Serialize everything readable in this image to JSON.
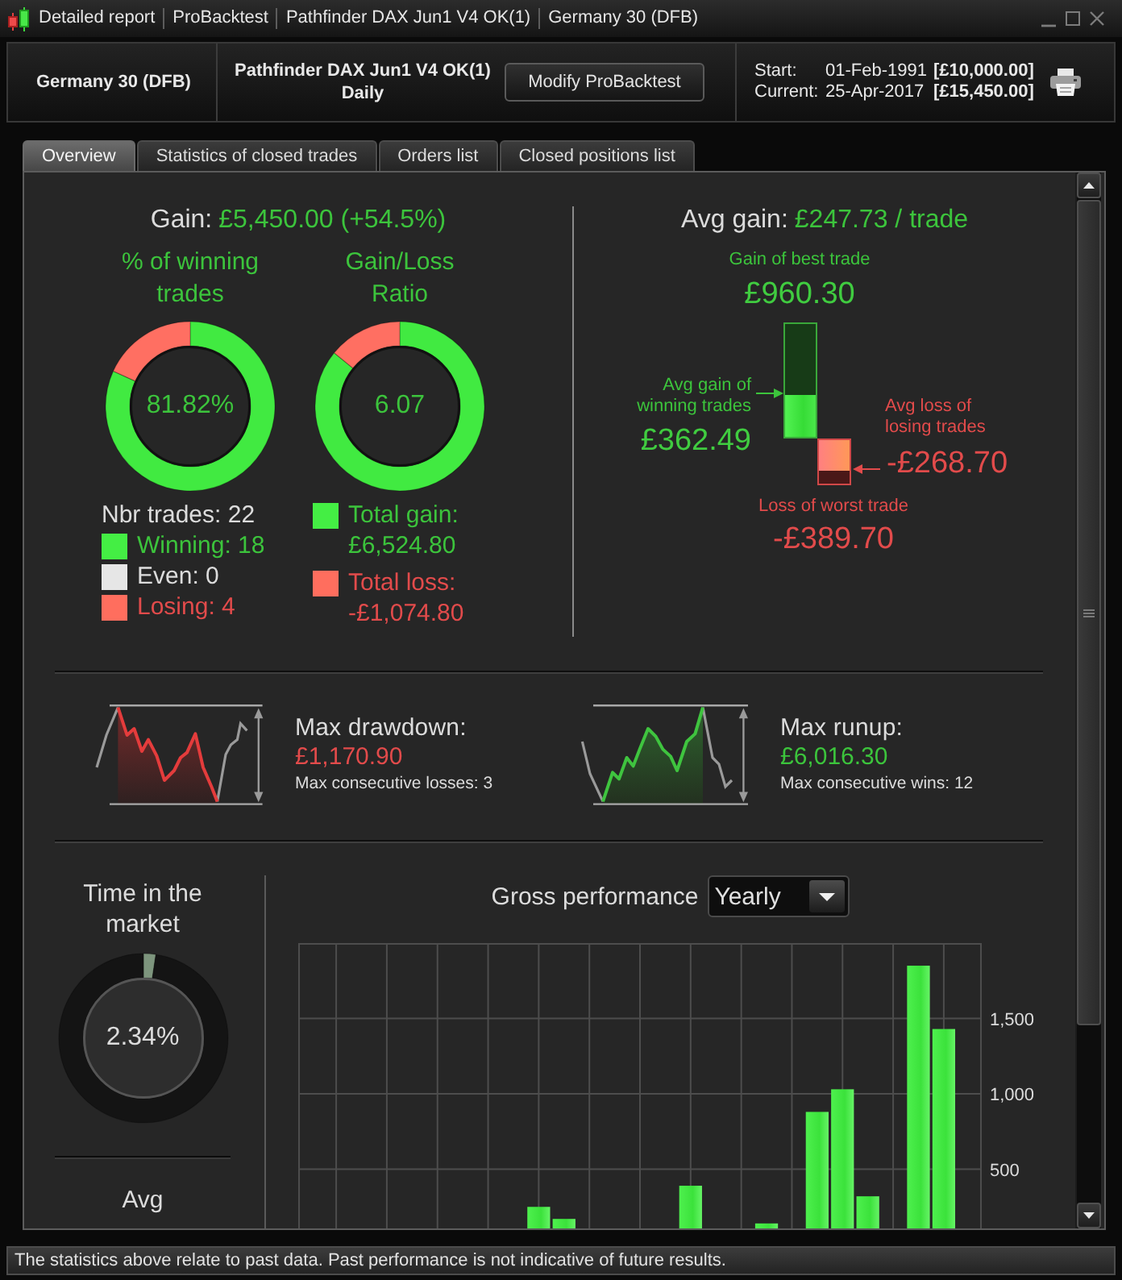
{
  "window": {
    "title_parts": [
      "Detailed report",
      "ProBacktest",
      "Pathfinder DAX Jun1 V4 OK(1)",
      "Germany 30 (DFB)"
    ]
  },
  "header": {
    "instrument": "Germany 30 (DFB)",
    "system": "Pathfinder DAX Jun1 V4 OK(1)",
    "timeframe": "Daily",
    "modify_button": "Modify ProBacktest",
    "capital_rows": [
      {
        "label": "Start:",
        "date": "01-Feb-1991",
        "amount": "[£10,000.00]"
      },
      {
        "label": "Current:",
        "date": "25-Apr-2017",
        "amount": "[£15,450.00]"
      }
    ]
  },
  "tabs": [
    {
      "label": "Overview",
      "selected": true
    },
    {
      "label": "Statistics of closed trades",
      "selected": false
    },
    {
      "label": "Orders list",
      "selected": false
    },
    {
      "label": "Closed positions list",
      "selected": false
    }
  ],
  "overview": {
    "gain": {
      "label": "Gain:",
      "value": "£5,450.00 (+54.5%)"
    },
    "winning_rate": {
      "title": "% of winning trades",
      "reading": "81.82%",
      "chart_data": {
        "type": "donut",
        "values": [
          81.82,
          18.18
        ]
      }
    },
    "gain_loss_ratio": {
      "title": "Gain/Loss Ratio",
      "reading": "6.07",
      "chart_data": {
        "type": "donut",
        "values": [
          85.86,
          14.14
        ]
      }
    },
    "trades": {
      "count": "Nbr trades: 22",
      "items": [
        {
          "kind": "win",
          "label": "Winning: 18",
          "color": "#44ee44"
        },
        {
          "kind": "even",
          "label": "Even: 0",
          "color": "#e6e6e6"
        },
        {
          "kind": "loss",
          "label": "Losing: 4",
          "color": "#ff6e5e"
        }
      ]
    },
    "totals": [
      {
        "kind": "win",
        "label": "Total gain:",
        "value": "£6,524.80",
        "color": "#44ee44"
      },
      {
        "kind": "loss",
        "label": "Total loss:",
        "value": "-£1,074.80",
        "color": "#ff6e5e"
      }
    ],
    "avg_gain": {
      "label": "Avg gain:",
      "value": "£247.73 / trade"
    },
    "best_trade": {
      "label": "Gain of best trade",
      "value": "£960.30"
    },
    "avg_winning": {
      "label": "Avg gain of winning trades",
      "value": "£362.49",
      "level": 0.3775
    },
    "avg_losing": {
      "label": "Avg loss of losing trades",
      "value": "-£268.70",
      "level": 0.6895
    },
    "worst_trade": {
      "label": "Loss of worst trade",
      "value": "-£389.70"
    },
    "extremes": [
      {
        "kind": "drawdown",
        "label": "Max drawdown:",
        "value": "£1,170.90",
        "note": "Max consecutive losses: 3"
      },
      {
        "kind": "runup",
        "label": "Max runup:",
        "value": "£6,016.30",
        "note": "Max consecutive wins: 12"
      }
    ],
    "time_in_market": {
      "title": "Time in the market",
      "reading": "2.34%",
      "chart_data": {
        "type": "donut",
        "values": [
          2.34,
          97.66
        ]
      }
    },
    "next_panel": {
      "title": "Avg"
    },
    "gross_performance": {
      "label": "Gross performance",
      "period": "Yearly",
      "chart_data": {
        "type": "bar",
        "values": [
          null,
          null,
          null,
          null,
          null,
          null,
          null,
          null,
          null,
          250,
          170,
          null,
          null,
          null,
          null,
          390,
          null,
          null,
          140,
          null,
          880,
          1030,
          320,
          null,
          1850,
          1430,
          null
        ],
        "ylim": [
          0,
          2000
        ],
        "yticks": [
          {
            "value": 500,
            "label": "500"
          },
          {
            "value": 1000,
            "label": "1,000"
          },
          {
            "value": 1500,
            "label": "1,500"
          }
        ],
        "grid": true
      }
    }
  },
  "status_bar": "The statistics above relate to past data. Past performance is not indicative of future results."
}
